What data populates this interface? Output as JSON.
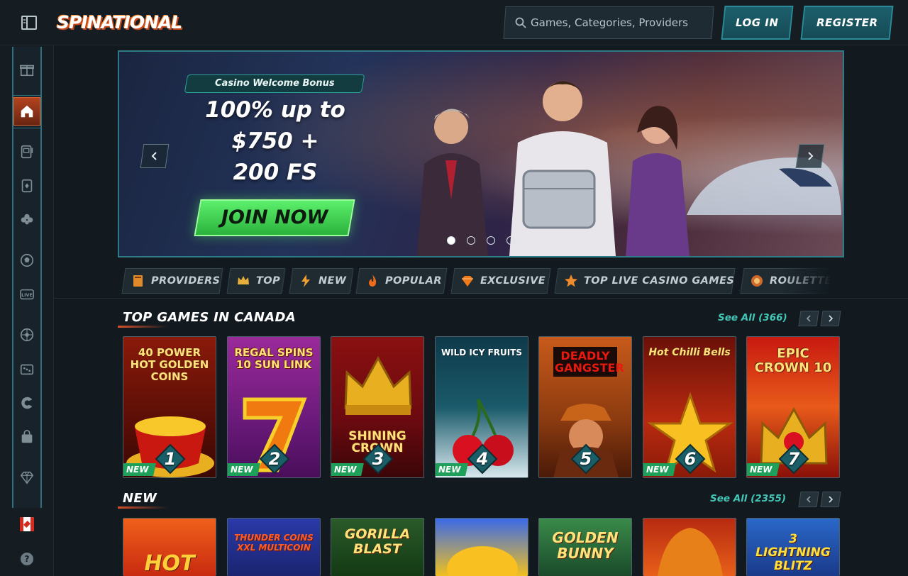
{
  "header": {
    "logo_text": "SPINATIONAL",
    "search_placeholder": "Games, Categories, Providers",
    "login_label": "LOG IN",
    "register_label": "REGISTER"
  },
  "sidebar": {
    "items": [
      {
        "icon": "gift-icon"
      },
      {
        "icon": "home-icon",
        "active": true
      },
      {
        "icon": "slot-machine-icon"
      },
      {
        "icon": "card-icon"
      },
      {
        "icon": "clover-icon"
      },
      {
        "icon": "sports-ball-icon"
      },
      {
        "icon": "live-icon",
        "text": "LIVE"
      },
      {
        "icon": "roulette-icon"
      },
      {
        "icon": "dice-icon"
      },
      {
        "icon": "crash-icon"
      },
      {
        "icon": "shop-bag-icon"
      },
      {
        "icon": "diamond-icon"
      }
    ],
    "help_label": "?"
  },
  "banner": {
    "bonus_label": "Casino Welcome Bonus",
    "offer_lines": [
      "100% up to",
      "$750 +",
      "200 FS"
    ],
    "cta_label": "JOIN NOW",
    "slide_count": 4,
    "active_slide": 1
  },
  "categories": [
    {
      "label": "PROVIDERS",
      "icon": "book-icon"
    },
    {
      "label": "TOP",
      "icon": "crown-icon"
    },
    {
      "label": "NEW",
      "icon": "lightning-icon"
    },
    {
      "label": "POPULAR",
      "icon": "flame-icon"
    },
    {
      "label": "EXCLUSIVE",
      "icon": "gem-icon"
    },
    {
      "label": "TOP LIVE CASINO GAMES",
      "icon": "star-icon"
    },
    {
      "label": "ROULETTE",
      "icon": "roulette-icon"
    }
  ],
  "sections": {
    "top": {
      "title": "TOP GAMES IN CANADA",
      "see_all": "See All (366)",
      "games": [
        {
          "title": "40 POWER HOT GOLDEN COINS",
          "rank": "1",
          "badge": "NEW",
          "bg": "#7a1409"
        },
        {
          "title": "REGAL SPINS 10 SUN LINK",
          "rank": "2",
          "badge": "NEW",
          "bg": "#5a1a6a"
        },
        {
          "title": "SHINING CROWN",
          "rank": "3",
          "badge": "NEW",
          "bg": "#6a0e14"
        },
        {
          "title": "WILD ICY FRUITS",
          "rank": "4",
          "badge": "NEW",
          "bg": "#0d3040"
        },
        {
          "title": "DEADLY GANGSTER",
          "rank": "5",
          "badge": "",
          "bg": "#8a3a12"
        },
        {
          "title": "Hot Chilli Bells",
          "rank": "6",
          "badge": "NEW",
          "bg": "#6a1008"
        },
        {
          "title": "EPIC CROWN 10",
          "rank": "7",
          "badge": "NEW",
          "bg": "#8a1810"
        }
      ]
    },
    "new": {
      "title": "NEW",
      "see_all": "See All (2355)",
      "games": [
        {
          "title": "HOT",
          "bg": "#d04010"
        },
        {
          "title": "THUNDER COINS XXL MULTICOIN",
          "bg": "#1a2c8a"
        },
        {
          "title": "GORILLA BLAST",
          "bg": "#1a4a1a"
        },
        {
          "title": "",
          "bg": "#3a6ad8"
        },
        {
          "title": "GOLDEN BUNNY",
          "bg": "#2a6a3a"
        },
        {
          "title": "",
          "bg": "#8a1a10"
        },
        {
          "title": "3 LIGHTNING BLITZ",
          "bg": "#1a58b0"
        }
      ]
    }
  }
}
